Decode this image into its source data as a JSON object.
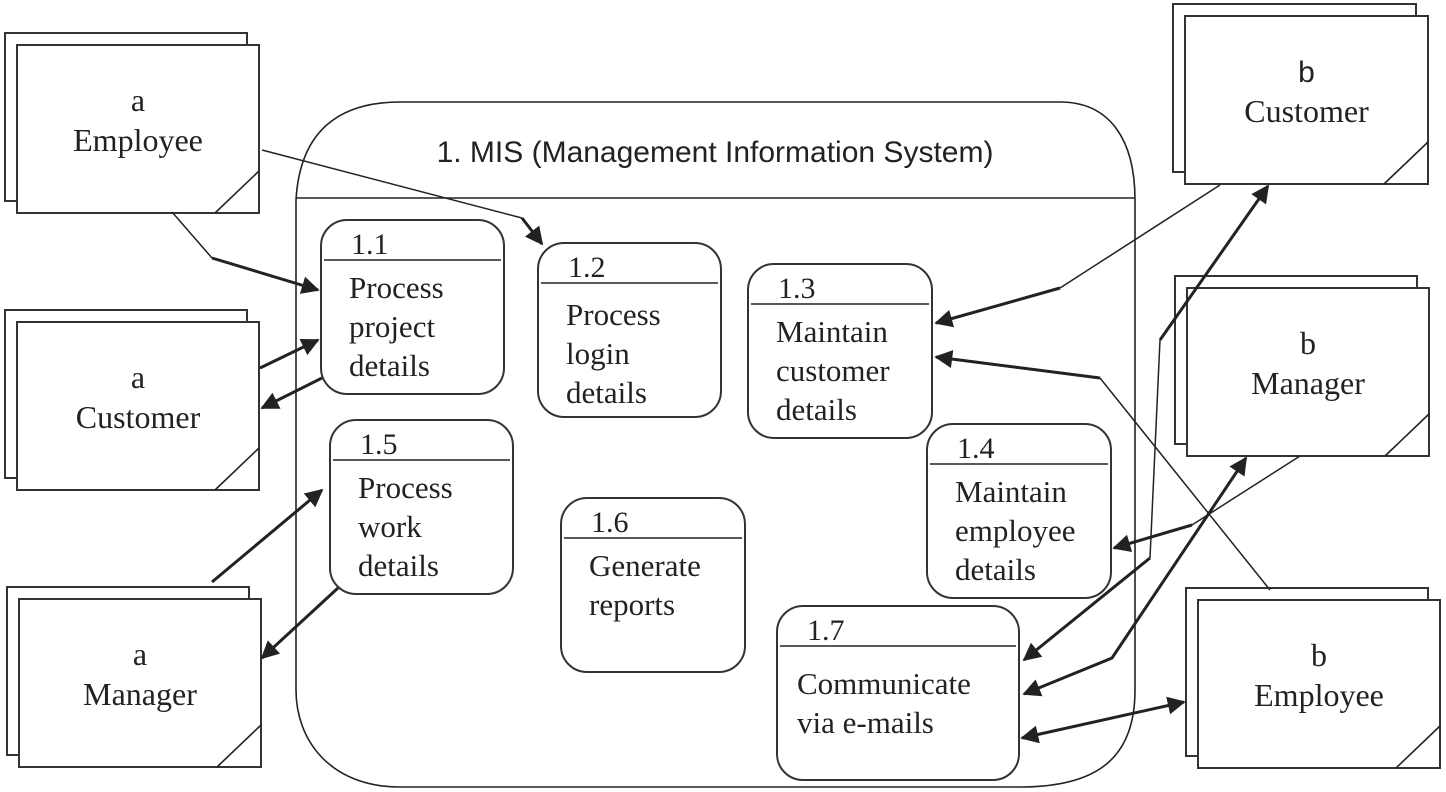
{
  "system": {
    "title": "1. MIS (Management Information System)"
  },
  "external_entities": [
    {
      "id": "a-employee",
      "letter": "a",
      "name": "Employee"
    },
    {
      "id": "a-customer",
      "letter": "a",
      "name": "Customer"
    },
    {
      "id": "a-manager",
      "letter": "a",
      "name": "Manager"
    },
    {
      "id": "b-customer",
      "letter": "b",
      "name": "Customer"
    },
    {
      "id": "b-manager",
      "letter": "b",
      "name": "Manager"
    },
    {
      "id": "b-employee",
      "letter": "b",
      "name": "Employee"
    }
  ],
  "processes": [
    {
      "id": "1.1",
      "number": "1.1",
      "lines": [
        "Process",
        "project",
        "details"
      ]
    },
    {
      "id": "1.2",
      "number": "1.2",
      "lines": [
        "Process",
        "login",
        "details"
      ]
    },
    {
      "id": "1.3",
      "number": "1.3",
      "lines": [
        "Maintain",
        "customer",
        "details"
      ]
    },
    {
      "id": "1.4",
      "number": "1.4",
      "lines": [
        "Maintain",
        "employee",
        "details"
      ]
    },
    {
      "id": "1.5",
      "number": "1.5",
      "lines": [
        "Process",
        "work",
        "details"
      ]
    },
    {
      "id": "1.6",
      "number": "1.6",
      "lines": [
        "Generate",
        "reports"
      ]
    },
    {
      "id": "1.7",
      "number": "1.7",
      "lines": [
        "Communicate",
        "via e-mails"
      ]
    }
  ],
  "flows": [
    {
      "from": "a-employee",
      "to": "1.1",
      "direction": "one-way"
    },
    {
      "from": "a-employee",
      "to": "1.2",
      "direction": "one-way"
    },
    {
      "from": "a-customer",
      "to": "1.1",
      "direction": "one-way"
    },
    {
      "from": "1.1",
      "to": "a-customer",
      "direction": "one-way"
    },
    {
      "from": "a-manager",
      "to": "1.5",
      "direction": "one-way"
    },
    {
      "from": "1.5",
      "to": "a-manager",
      "direction": "one-way"
    },
    {
      "from": "b-customer",
      "to": "1.3",
      "direction": "one-way"
    },
    {
      "from": "b-employee",
      "to": "1.3",
      "direction": "one-way"
    },
    {
      "from": "b-manager",
      "to": "1.4",
      "direction": "one-way"
    },
    {
      "from": "1.4",
      "to": "1.7",
      "direction": "one-way"
    },
    {
      "from": "1.7",
      "to": "b-customer",
      "direction": "one-way"
    },
    {
      "from": "1.7",
      "to": "b-manager",
      "direction": "two-way"
    },
    {
      "from": "1.7",
      "to": "b-employee",
      "direction": "two-way"
    }
  ]
}
